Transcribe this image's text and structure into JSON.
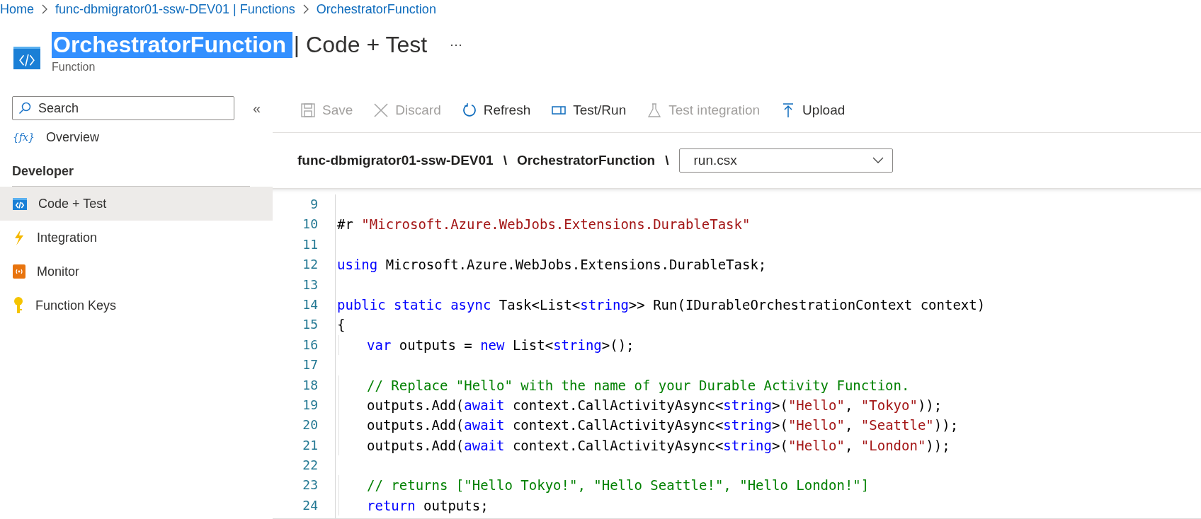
{
  "breadcrumb": [
    "Home",
    "func-dbmigrator01-ssw-DEV01 | Functions",
    "OrchestratorFunction"
  ],
  "header": {
    "title_selected": "OrchestratorFunction ",
    "title_rest": "| Code + Test",
    "more": "···",
    "subtitle": "Function"
  },
  "sidebar": {
    "search": {
      "placeholder": "Search"
    },
    "collapse": "«",
    "items": [
      {
        "kind": "item",
        "glyph": "{fx}",
        "label": "Overview",
        "selected": false
      },
      {
        "kind": "section",
        "label": "Developer"
      },
      {
        "kind": "item",
        "label": "Code + Test",
        "selected": true
      },
      {
        "kind": "item",
        "label": "Integration",
        "selected": false
      },
      {
        "kind": "item",
        "label": "Monitor",
        "selected": false
      },
      {
        "kind": "item",
        "label": "Function Keys",
        "selected": false
      }
    ]
  },
  "toolbar": [
    {
      "label": "Save",
      "disabled": true
    },
    {
      "label": "Discard",
      "disabled": true
    },
    {
      "label": "Refresh",
      "disabled": false
    },
    {
      "label": "Test/Run",
      "disabled": false
    },
    {
      "label": "Test integration",
      "disabled": true
    },
    {
      "label": "Upload",
      "disabled": false
    }
  ],
  "path": {
    "segments": [
      "func-dbmigrator01-ssw-DEV01",
      "\\",
      "OrchestratorFunction",
      "\\"
    ],
    "file": "run.csx"
  },
  "code": [
    {
      "n": "9"
    },
    {
      "n": "10",
      "tokens": [
        {
          "kind": "plain",
          "t": "#r "
        },
        {
          "kind": "string",
          "t": "\"Microsoft.Azure.WebJobs.Extensions.DurableTask\""
        }
      ]
    },
    {
      "n": "11"
    },
    {
      "n": "12",
      "tokens": [
        {
          "kind": "keyword",
          "t": "using"
        },
        {
          "kind": "plain",
          "t": " Microsoft.Azure.WebJobs.Extensions.DurableTask;"
        }
      ]
    },
    {
      "n": "13"
    },
    {
      "n": "14",
      "tokens": [
        {
          "kind": "keyword",
          "t": "public static async"
        },
        {
          "kind": "plain",
          "t": " Task<List<"
        },
        {
          "kind": "keyword",
          "t": "string"
        },
        {
          "kind": "plain",
          "t": ">> Run(IDurableOrchestrationContext context)"
        }
      ]
    },
    {
      "n": "15",
      "tokens": [
        {
          "kind": "plain",
          "t": "{"
        }
      ]
    },
    {
      "n": "16",
      "indent": true,
      "tokens": [
        {
          "kind": "keyword",
          "t": "var"
        },
        {
          "kind": "plain",
          "t": " outputs = "
        },
        {
          "kind": "keyword",
          "t": "new"
        },
        {
          "kind": "plain",
          "t": " List<"
        },
        {
          "kind": "keyword",
          "t": "string"
        },
        {
          "kind": "plain",
          "t": ">();"
        }
      ]
    },
    {
      "n": "17"
    },
    {
      "n": "18",
      "indent": true,
      "tokens": [
        {
          "kind": "comment",
          "t": "// Replace \"Hello\" with the name of your Durable Activity Function."
        }
      ]
    },
    {
      "n": "19",
      "indent": true,
      "tokens": [
        {
          "kind": "plain",
          "t": "outputs.Add("
        },
        {
          "kind": "keyword",
          "t": "await"
        },
        {
          "kind": "plain",
          "t": " context.CallActivityAsync<"
        },
        {
          "kind": "keyword",
          "t": "string"
        },
        {
          "kind": "plain",
          "t": ">("
        },
        {
          "kind": "string",
          "t": "\"Hello\""
        },
        {
          "kind": "plain",
          "t": ", "
        },
        {
          "kind": "string",
          "t": "\"Tokyo\""
        },
        {
          "kind": "plain",
          "t": "));"
        }
      ]
    },
    {
      "n": "20",
      "indent": true,
      "tokens": [
        {
          "kind": "plain",
          "t": "outputs.Add("
        },
        {
          "kind": "keyword",
          "t": "await"
        },
        {
          "kind": "plain",
          "t": " context.CallActivityAsync<"
        },
        {
          "kind": "keyword",
          "t": "string"
        },
        {
          "kind": "plain",
          "t": ">("
        },
        {
          "kind": "string",
          "t": "\"Hello\""
        },
        {
          "kind": "plain",
          "t": ", "
        },
        {
          "kind": "string",
          "t": "\"Seattle\""
        },
        {
          "kind": "plain",
          "t": "));"
        }
      ]
    },
    {
      "n": "21",
      "indent": true,
      "tokens": [
        {
          "kind": "plain",
          "t": "outputs.Add("
        },
        {
          "kind": "keyword",
          "t": "await"
        },
        {
          "kind": "plain",
          "t": " context.CallActivityAsync<"
        },
        {
          "kind": "keyword",
          "t": "string"
        },
        {
          "kind": "plain",
          "t": ">("
        },
        {
          "kind": "string",
          "t": "\"Hello\""
        },
        {
          "kind": "plain",
          "t": ", "
        },
        {
          "kind": "string",
          "t": "\"London\""
        },
        {
          "kind": "plain",
          "t": "));"
        }
      ]
    },
    {
      "n": "22"
    },
    {
      "n": "23",
      "indent": true,
      "tokens": [
        {
          "kind": "comment",
          "t": "// returns [\"Hello Tokyo!\", \"Hello Seattle!\", \"Hello London!\"]"
        }
      ]
    },
    {
      "n": "24",
      "indent": true,
      "tokens": [
        {
          "kind": "keyword",
          "t": "return"
        },
        {
          "kind": "plain",
          "t": " outputs;"
        }
      ]
    }
  ]
}
